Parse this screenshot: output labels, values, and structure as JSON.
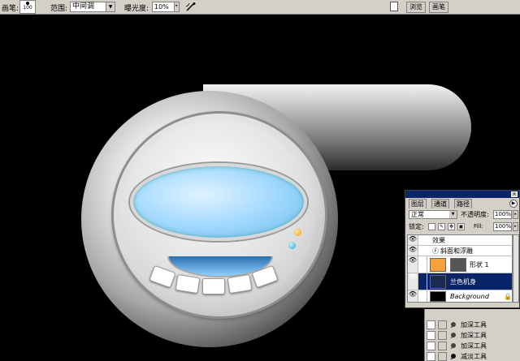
{
  "options_bar": {
    "brush_label": "画笔:",
    "brush_size": "100",
    "range_label": "范围:",
    "range_value": "中间调",
    "exposure_label": "曝光度:",
    "exposure_value": "10%",
    "tab_navigator": "浏览",
    "tab_brushes": "画笔"
  },
  "layers_palette": {
    "tabs": [
      "图层",
      "通道",
      "路径"
    ],
    "blend_mode": "正常",
    "opacity_label": "不透明度:",
    "opacity_value": "100%",
    "lock_label": "锁定:",
    "fill_label": "Fill:",
    "fill_value": "100%",
    "layers": [
      {
        "name": "效果",
        "kind": "effects-header"
      },
      {
        "name": "斜面和浮雕",
        "kind": "effect"
      },
      {
        "name": "形状 1",
        "kind": "shape",
        "color": "#f5a13c"
      },
      {
        "name": "兰色机身",
        "kind": "layer",
        "selected": true
      },
      {
        "name": "Background",
        "kind": "background"
      }
    ]
  },
  "history_palette": {
    "items": [
      "加深工具",
      "加深工具",
      "加深工具",
      "减淡工具"
    ]
  },
  "colors": {
    "chrome": "#d4d0c8",
    "selection": "#0a246a",
    "visor_blue": "#a8dcff",
    "led_orange": "#f09a10",
    "led_cyan": "#1aa6c9"
  }
}
